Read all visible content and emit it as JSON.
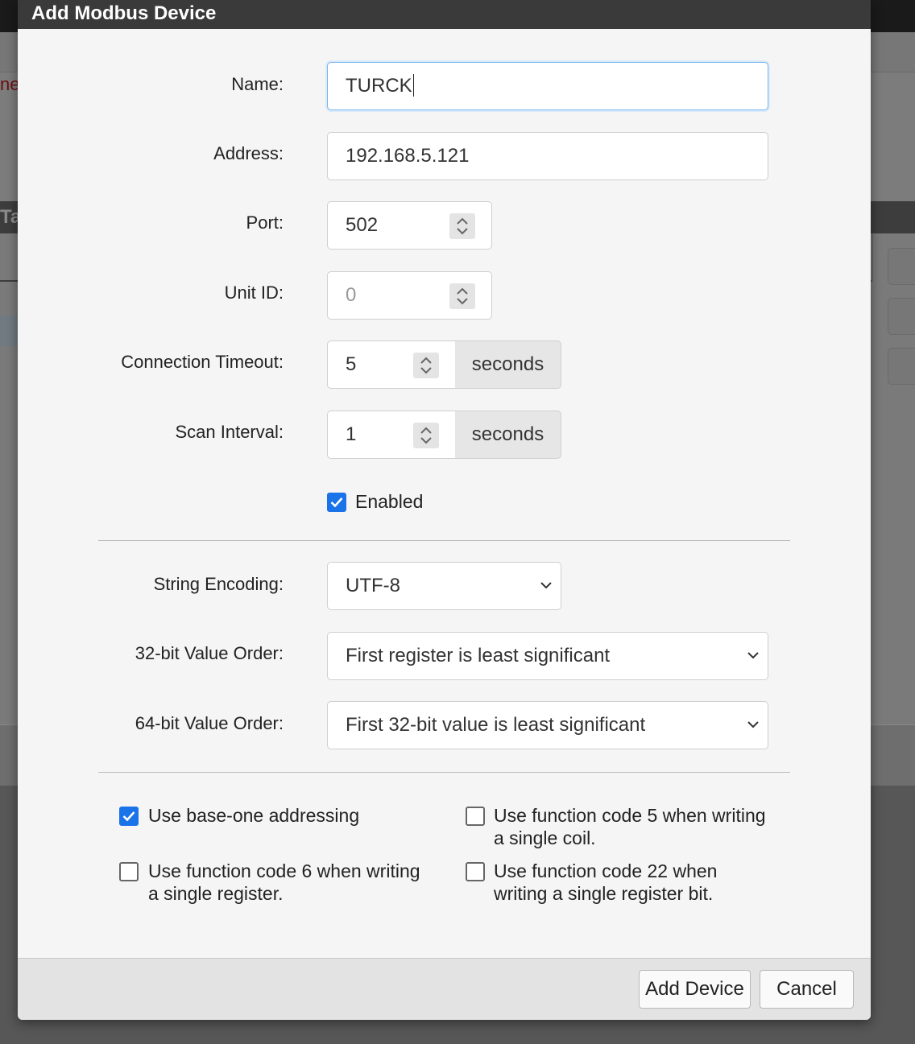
{
  "dialog": {
    "title": "Add Modbus Device",
    "fields": {
      "name": {
        "label": "Name:",
        "value": "TURCK"
      },
      "address": {
        "label": "Address:",
        "value": "192.168.5.121"
      },
      "port": {
        "label": "Port:",
        "value": "502"
      },
      "unit_id": {
        "label": "Unit ID:",
        "placeholder": "0"
      },
      "connection_timeout": {
        "label": "Connection Timeout:",
        "value": "5",
        "unit": "seconds"
      },
      "scan_interval": {
        "label": "Scan Interval:",
        "value": "1",
        "unit": "seconds"
      },
      "enabled": {
        "label": "Enabled",
        "checked": true
      },
      "string_encoding": {
        "label": "String Encoding:",
        "value": "UTF-8"
      },
      "value_order_32": {
        "label": "32-bit Value Order:",
        "value": "First register is least significant"
      },
      "value_order_64": {
        "label": "64-bit Value Order:",
        "value": "First 32-bit value is least significant"
      }
    },
    "options": {
      "base_one": {
        "label": "Use base-one addressing",
        "checked": true
      },
      "fc5_line1": "Use function code 5 when writing",
      "fc5_line2": "a single coil.",
      "fc5_checked": false,
      "fc6_line1": "Use function code 6 when writing",
      "fc6_line2": "a single register.",
      "fc6_checked": false,
      "fc22_line1": "Use function code 22 when",
      "fc22_line2": "writing a single register bit.",
      "fc22_checked": false
    },
    "buttons": {
      "add": "Add Device",
      "cancel": "Cancel"
    }
  },
  "background": {
    "red_text": "ne",
    "window_title": "Ta"
  },
  "colors": {
    "accent": "#1a73e8",
    "header": "#3a3a3a",
    "focus": "#79b4ea"
  }
}
